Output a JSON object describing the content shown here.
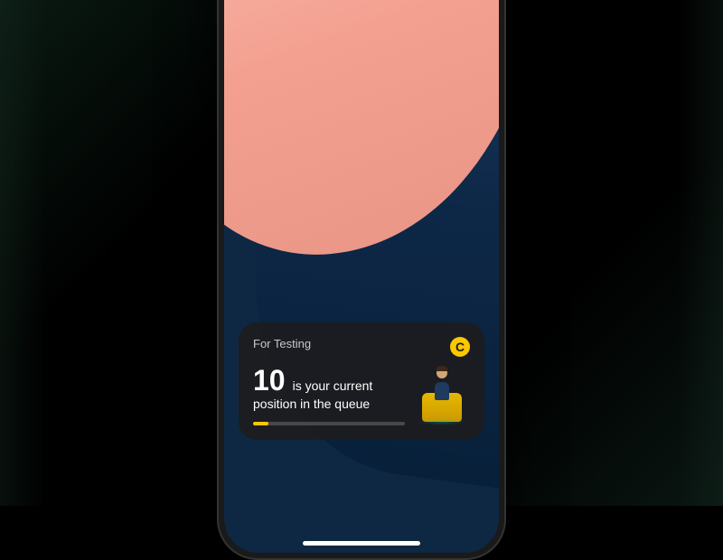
{
  "card": {
    "title": "For Testing",
    "icon_glyph": "C",
    "queue_position": "10",
    "status_line_1": "is your current",
    "status_line_2": "position in the queue"
  },
  "colors": {
    "accent": "#fac800",
    "card_bg": "#1c1c1e",
    "wallpaper_pink": "#f4a090",
    "wallpaper_blue": "#0e2843"
  }
}
